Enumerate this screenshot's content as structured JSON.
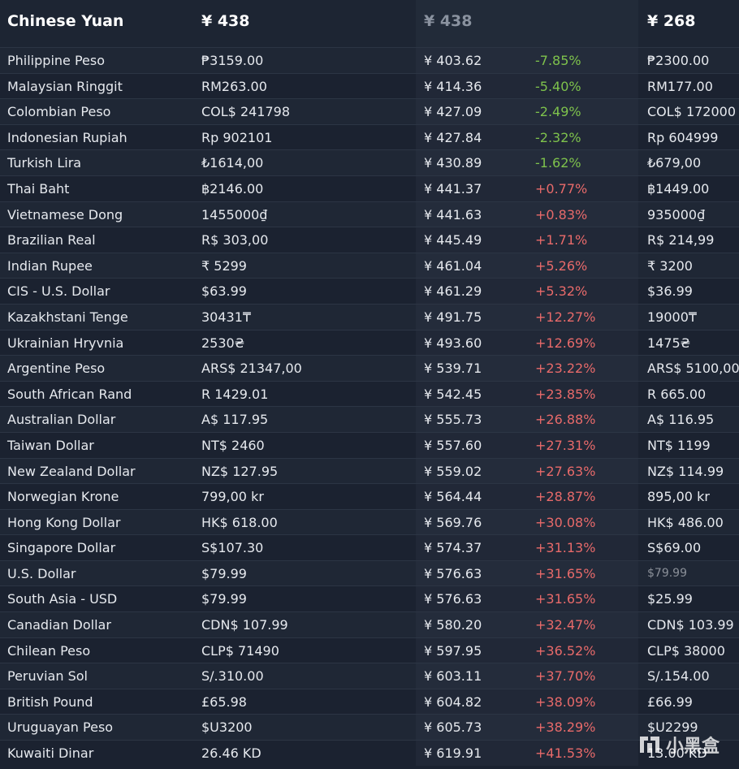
{
  "header": {
    "currency": "Chinese Yuan",
    "price": "¥ 438",
    "converted": "¥ 438",
    "other_price": "¥ 268"
  },
  "rows": [
    {
      "name": "Philippine Peso",
      "price": "₱3159.00",
      "converted": "¥ 403.62",
      "pct": "-7.85%",
      "other": "₱2300.00"
    },
    {
      "name": "Malaysian Ringgit",
      "price": "RM263.00",
      "converted": "¥ 414.36",
      "pct": "-5.40%",
      "other": "RM177.00"
    },
    {
      "name": "Colombian Peso",
      "price": "COL$ 241798",
      "converted": "¥ 427.09",
      "pct": "-2.49%",
      "other": "COL$ 172000"
    },
    {
      "name": "Indonesian Rupiah",
      "price": "Rp 902101",
      "converted": "¥ 427.84",
      "pct": "-2.32%",
      "other": "Rp 604999"
    },
    {
      "name": "Turkish Lira",
      "price": "₺1614,00",
      "converted": "¥ 430.89",
      "pct": "-1.62%",
      "other": "₺679,00"
    },
    {
      "name": "Thai Baht",
      "price": "฿2146.00",
      "converted": "¥ 441.37",
      "pct": "+0.77%",
      "other": "฿1449.00"
    },
    {
      "name": "Vietnamese Dong",
      "price": "1455000₫",
      "converted": "¥ 441.63",
      "pct": "+0.83%",
      "other": "935000₫"
    },
    {
      "name": "Brazilian Real",
      "price": "R$ 303,00",
      "converted": "¥ 445.49",
      "pct": "+1.71%",
      "other": "R$ 214,99"
    },
    {
      "name": "Indian Rupee",
      "price": "₹ 5299",
      "converted": "¥ 461.04",
      "pct": "+5.26%",
      "other": "₹ 3200"
    },
    {
      "name": "CIS - U.S. Dollar",
      "price": "$63.99",
      "converted": "¥ 461.29",
      "pct": "+5.32%",
      "other": "$36.99"
    },
    {
      "name": "Kazakhstani Tenge",
      "price": "30431₸",
      "converted": "¥ 491.75",
      "pct": "+12.27%",
      "other": "19000₸"
    },
    {
      "name": "Ukrainian Hryvnia",
      "price": "2530₴",
      "converted": "¥ 493.60",
      "pct": "+12.69%",
      "other": "1475₴"
    },
    {
      "name": "Argentine Peso",
      "price": "ARS$ 21347,00",
      "converted": "¥ 539.71",
      "pct": "+23.22%",
      "other": "ARS$ 5100,00"
    },
    {
      "name": "South African Rand",
      "price": "R 1429.01",
      "converted": "¥ 542.45",
      "pct": "+23.85%",
      "other": "R 665.00"
    },
    {
      "name": "Australian Dollar",
      "price": "A$ 117.95",
      "converted": "¥ 555.73",
      "pct": "+26.88%",
      "other": "A$ 116.95"
    },
    {
      "name": "Taiwan Dollar",
      "price": "NT$ 2460",
      "converted": "¥ 557.60",
      "pct": "+27.31%",
      "other": "NT$ 1199"
    },
    {
      "name": "New Zealand Dollar",
      "price": "NZ$ 127.95",
      "converted": "¥ 559.02",
      "pct": "+27.63%",
      "other": "NZ$ 114.99"
    },
    {
      "name": "Norwegian Krone",
      "price": "799,00 kr",
      "converted": "¥ 564.44",
      "pct": "+28.87%",
      "other": "895,00 kr"
    },
    {
      "name": "Hong Kong Dollar",
      "price": "HK$ 618.00",
      "converted": "¥ 569.76",
      "pct": "+30.08%",
      "other": "HK$ 486.00"
    },
    {
      "name": "Singapore Dollar",
      "price": "S$107.30",
      "converted": "¥ 574.37",
      "pct": "+31.13%",
      "other": "S$69.00"
    },
    {
      "name": "U.S. Dollar",
      "price": "$79.99",
      "converted": "¥ 576.63",
      "pct": "+31.65%",
      "other": "$79.99",
      "other_muted": true
    },
    {
      "name": "South Asia - USD",
      "price": "$79.99",
      "converted": "¥ 576.63",
      "pct": "+31.65%",
      "other": "$25.99"
    },
    {
      "name": "Canadian Dollar",
      "price": "CDN$ 107.99",
      "converted": "¥ 580.20",
      "pct": "+32.47%",
      "other": "CDN$ 103.99"
    },
    {
      "name": "Chilean Peso",
      "price": "CLP$ 71490",
      "converted": "¥ 597.95",
      "pct": "+36.52%",
      "other": "CLP$ 38000"
    },
    {
      "name": "Peruvian Sol",
      "price": "S/.310.00",
      "converted": "¥ 603.11",
      "pct": "+37.70%",
      "other": "S/.154.00"
    },
    {
      "name": "British Pound",
      "price": "£65.98",
      "converted": "¥ 604.82",
      "pct": "+38.09%",
      "other": "£66.99"
    },
    {
      "name": "Uruguayan Peso",
      "price": "$U3200",
      "converted": "¥ 605.73",
      "pct": "+38.29%",
      "other": "$U2299"
    },
    {
      "name": "Kuwaiti Dinar",
      "price": "26.46 KD",
      "converted": "¥ 619.91",
      "pct": "+41.53%",
      "other": "13.00 KD"
    }
  ],
  "watermark": {
    "text": "小黑盒",
    "icon": "xiaoheihe-logo-icon"
  },
  "colors": {
    "negative": "#7ec24c",
    "positive": "#e86a6a",
    "background": "#1b2230"
  }
}
